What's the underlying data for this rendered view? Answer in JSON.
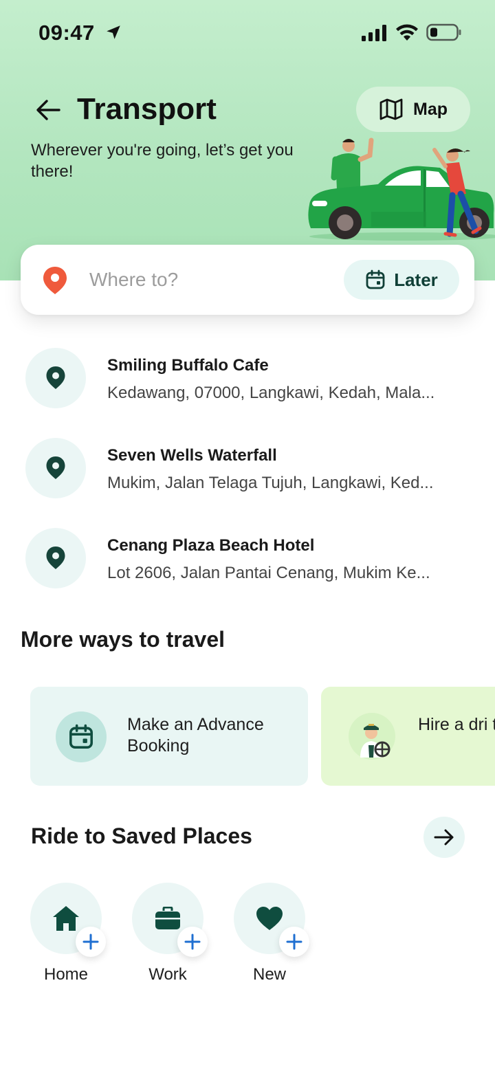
{
  "status_bar": {
    "time": "09:47"
  },
  "header": {
    "title": "Transport",
    "subtitle": "Wherever you're going, let’s get you there!",
    "map_label": "Map"
  },
  "search": {
    "placeholder": "Where to?",
    "later_label": "Later"
  },
  "recent_places": [
    {
      "name": "Smiling Buffalo Cafe",
      "address": "Kedawang, 07000, Langkawi, Kedah, Mala..."
    },
    {
      "name": "Seven Wells Waterfall",
      "address": "Mukim, Jalan Telaga Tujuh, Langkawi, Ked..."
    },
    {
      "name": "Cenang Plaza Beach Hotel",
      "address": "Lot 2606, Jalan Pantai Cenang, Mukim Ke..."
    }
  ],
  "more_ways": {
    "title": "More ways to travel",
    "cards": [
      {
        "label": "Make an Advance Booking",
        "icon": "calendar-icon"
      },
      {
        "label": "Hire a driver by the hour",
        "visible_label": "Hire a dri the hour",
        "icon": "driver-icon"
      }
    ]
  },
  "saved_places": {
    "title": "Ride to Saved Places",
    "items": [
      {
        "label": "Home",
        "icon": "home-icon"
      },
      {
        "label": "Work",
        "icon": "briefcase-icon"
      },
      {
        "label": "New",
        "icon": "heart-icon"
      }
    ]
  },
  "colors": {
    "accent_dark_green": "#0f4d3f",
    "hero_green": "#b3e6bf",
    "pin_red": "#ef5a3c",
    "plus_blue": "#1f6fd1",
    "icon_bg": "#ebf6f5"
  }
}
